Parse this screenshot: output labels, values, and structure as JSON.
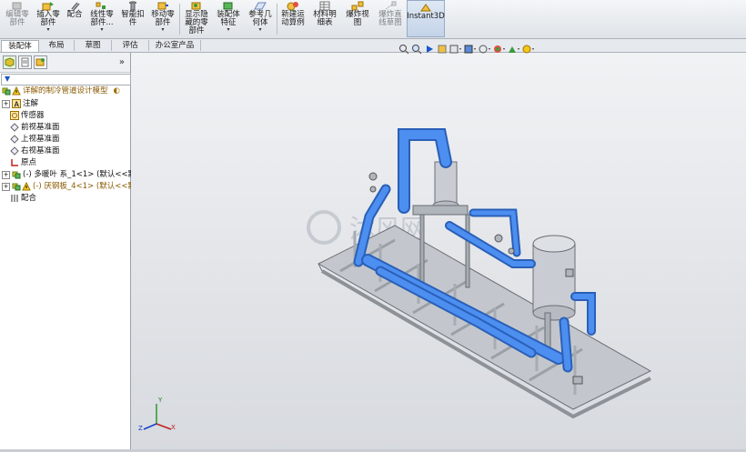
{
  "toolbar": {
    "items": [
      {
        "label": "编辑零\n部件",
        "disabled": true
      },
      {
        "label": "插入零\n部件",
        "disabled": false,
        "dropdown": true
      },
      {
        "label": "配合",
        "disabled": false
      },
      {
        "label": "线性零\n部件...",
        "disabled": false,
        "dropdown": true
      },
      {
        "label": "智能扣\n件",
        "disabled": false
      },
      {
        "label": "移动零\n部件",
        "disabled": false,
        "dropdown": true
      },
      {
        "label": "显示隐\n藏的零\n部件",
        "disabled": false
      },
      {
        "label": "装配体\n特征",
        "disabled": false,
        "dropdown": true
      },
      {
        "label": "参考几\n何体",
        "disabled": false,
        "dropdown": true
      },
      {
        "label": "新建运\n动算例",
        "disabled": false
      },
      {
        "label": "材料明\n细表",
        "disabled": false
      },
      {
        "label": "爆炸视\n图",
        "disabled": false
      },
      {
        "label": "爆炸直\n线草图",
        "disabled": true
      },
      {
        "label": "Instant3D",
        "disabled": false
      }
    ]
  },
  "tabs": [
    "装配体",
    "布局",
    "草图",
    "评估",
    "办公室产品"
  ],
  "panel": {
    "collapse_label": "»",
    "tree": [
      {
        "label": "详解的制冷管道设计模型",
        "kind": "root"
      },
      {
        "label": "注解",
        "kind": "annotation"
      },
      {
        "label": "传感器",
        "kind": "sensor"
      },
      {
        "label": "前视基准面",
        "kind": "plane"
      },
      {
        "label": "上视基准面",
        "kind": "plane"
      },
      {
        "label": "右视基准面",
        "kind": "plane"
      },
      {
        "label": "原点",
        "kind": "origin"
      },
      {
        "label": "(-) 多暖叶 系_1<1> (默认<<默",
        "kind": "part"
      },
      {
        "label": "(-) 厌钢板_4<1> (默认<<默认",
        "kind": "part-warn"
      },
      {
        "label": "配合",
        "kind": "mates"
      }
    ]
  },
  "watermark": "沐风网",
  "triad": {
    "x": "X",
    "y": "Y",
    "z": "Z"
  },
  "colors": {
    "pipe": "#3d7fe6",
    "steel": "#c9cdd3",
    "accent": "#f4c81a"
  }
}
